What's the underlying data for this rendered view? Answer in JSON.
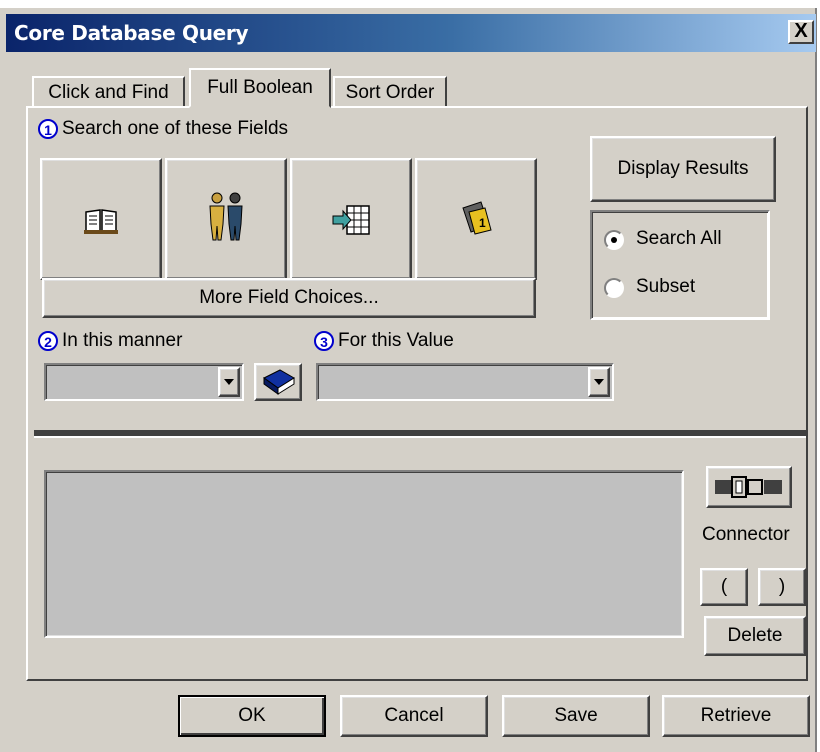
{
  "window": {
    "title": "Core Database Query",
    "close_label": "X"
  },
  "tabs": [
    {
      "label": "Click and Find"
    },
    {
      "label": "Full Boolean",
      "selected": true
    },
    {
      "label": "Sort Order"
    }
  ],
  "steps": {
    "step1": {
      "number": "1",
      "label": "Search one of these Fields"
    },
    "step2": {
      "number": "2",
      "label": "In this manner"
    },
    "step3": {
      "number": "3",
      "label": "For this Value"
    }
  },
  "field_buttons": [
    {
      "icon": "book-icon"
    },
    {
      "icon": "people-icon"
    },
    {
      "icon": "import-grid-icon"
    },
    {
      "icon": "tag-icon"
    }
  ],
  "more_fields_label": "More Field Choices...",
  "display_results_label": "Display Results",
  "search_scope": {
    "options": [
      {
        "label": "Search All",
        "selected": true
      },
      {
        "label": "Subset",
        "selected": false
      }
    ]
  },
  "manner_combo": {
    "value": ""
  },
  "value_combo": {
    "value": ""
  },
  "query_box": {
    "value": ""
  },
  "connector": {
    "label": "Connector",
    "icon": "connector-icon"
  },
  "paren_open_label": "(",
  "paren_close_label": ")",
  "delete_label": "Delete",
  "footer": {
    "ok_label": "OK",
    "cancel_label": "Cancel",
    "save_label": "Save",
    "retrieve_label": "Retrieve"
  }
}
